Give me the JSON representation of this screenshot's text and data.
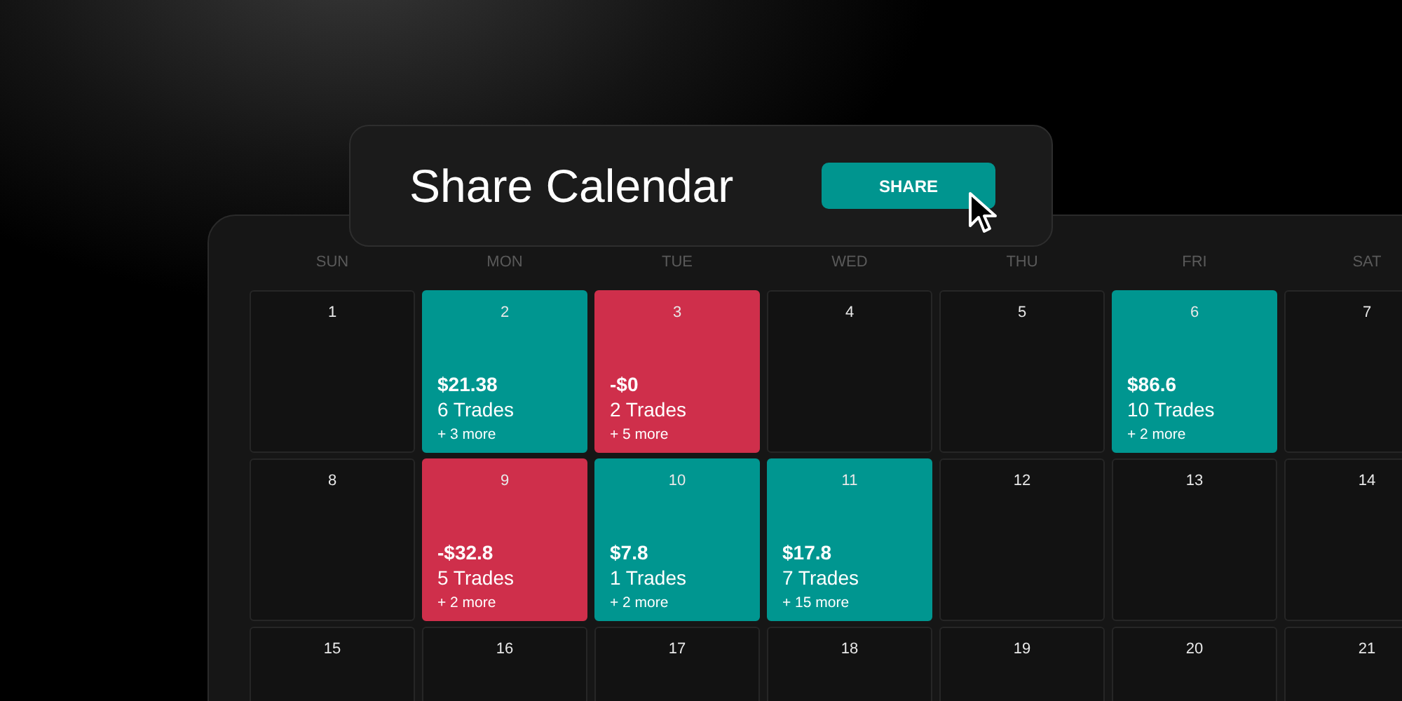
{
  "share_card": {
    "title": "Share Calendar",
    "button": "SHARE"
  },
  "calendar": {
    "weekdays": [
      "SUN",
      "MON",
      "TUE",
      "WED",
      "THU",
      "FRI",
      "SAT"
    ],
    "weeks": [
      [
        {
          "day": "1",
          "kind": "empty"
        },
        {
          "day": "2",
          "kind": "profit",
          "amount": "$21.38",
          "trades": "6 Trades",
          "more": "+ 3 more"
        },
        {
          "day": "3",
          "kind": "loss",
          "amount": "-$0",
          "trades": "2 Trades",
          "more": "+ 5 more"
        },
        {
          "day": "4",
          "kind": "empty"
        },
        {
          "day": "5",
          "kind": "empty"
        },
        {
          "day": "6",
          "kind": "profit",
          "amount": "$86.6",
          "trades": "10 Trades",
          "more": "+ 2 more"
        },
        {
          "day": "7",
          "kind": "empty"
        }
      ],
      [
        {
          "day": "8",
          "kind": "empty"
        },
        {
          "day": "9",
          "kind": "loss",
          "amount": "-$32.8",
          "trades": "5 Trades",
          "more": "+ 2 more"
        },
        {
          "day": "10",
          "kind": "profit",
          "amount": "$7.8",
          "trades": "1 Trades",
          "more": "+ 2 more"
        },
        {
          "day": "11",
          "kind": "profit",
          "amount": "$17.8",
          "trades": "7 Trades",
          "more": "+ 15 more"
        },
        {
          "day": "12",
          "kind": "empty"
        },
        {
          "day": "13",
          "kind": "empty"
        },
        {
          "day": "14",
          "kind": "empty"
        }
      ],
      [
        {
          "day": "15",
          "kind": "empty"
        },
        {
          "day": "16",
          "kind": "empty"
        },
        {
          "day": "17",
          "kind": "empty"
        },
        {
          "day": "18",
          "kind": "empty"
        },
        {
          "day": "19",
          "kind": "empty"
        },
        {
          "day": "20",
          "kind": "empty"
        },
        {
          "day": "21",
          "kind": "empty"
        }
      ]
    ]
  }
}
